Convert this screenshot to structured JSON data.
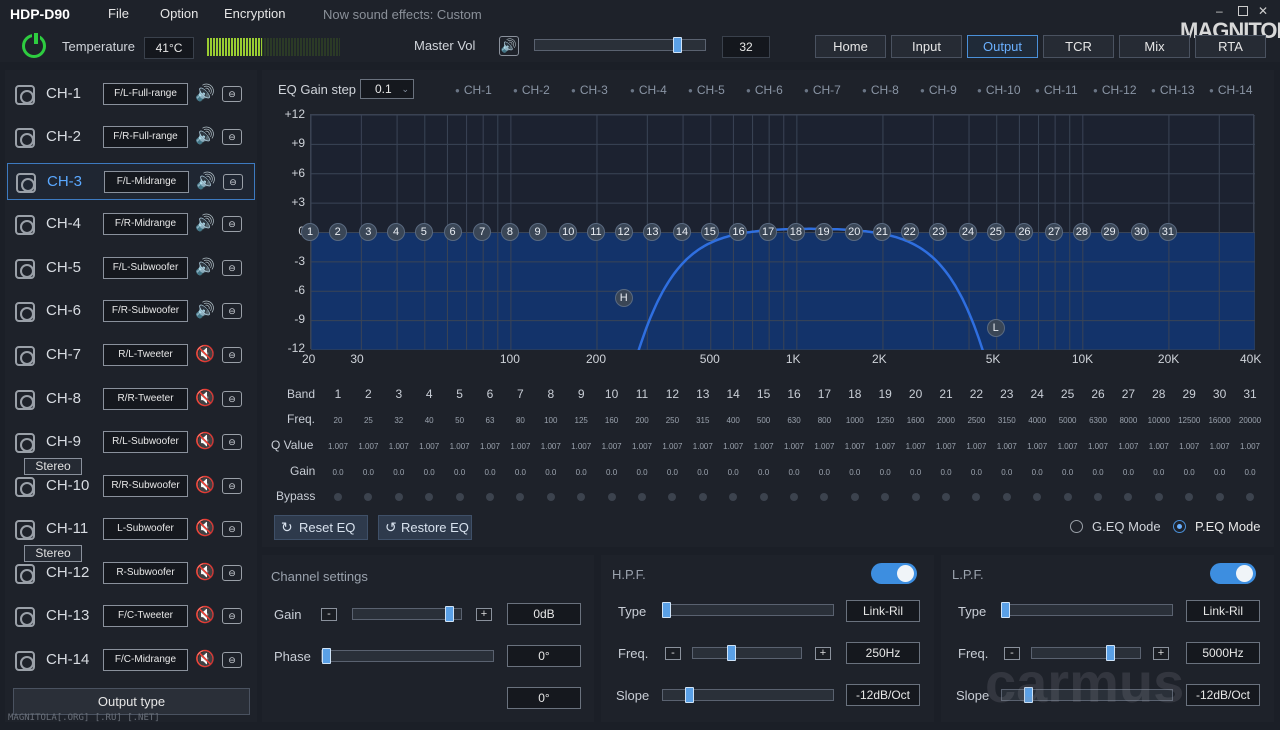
{
  "app": {
    "title": "HDP-D90",
    "menu": [
      "File",
      "Option",
      "Encryption"
    ],
    "sound_effects": "Now sound effects: Custom",
    "logo": "MAGNITOLA"
  },
  "header": {
    "temperature_label": "Temperature",
    "temperature": "41°C",
    "temperature_level": 0.41,
    "master_label": "Master Vol",
    "master_value": "32",
    "master_level": 0.83
  },
  "tabs": [
    {
      "label": "Home"
    },
    {
      "label": "Input"
    },
    {
      "label": "Output",
      "active": true
    },
    {
      "label": "TCR"
    },
    {
      "label": "Mix"
    },
    {
      "label": "RTA"
    }
  ],
  "channels": [
    {
      "name": "CH-1",
      "type": "F/L-Full-range",
      "muted": false
    },
    {
      "name": "CH-2",
      "type": "F/R-Full-range",
      "muted": false
    },
    {
      "name": "CH-3",
      "type": "F/L-Midrange",
      "muted": false,
      "selected": true
    },
    {
      "name": "CH-4",
      "type": "F/R-Midrange",
      "muted": false
    },
    {
      "name": "CH-5",
      "type": "F/L-Subwoofer",
      "muted": false
    },
    {
      "name": "CH-6",
      "type": "F/R-Subwoofer",
      "muted": false
    },
    {
      "name": "CH-7",
      "type": "R/L-Tweeter",
      "muted": true
    },
    {
      "name": "CH-8",
      "type": "R/R-Tweeter",
      "muted": true
    },
    {
      "name": "CH-9",
      "type": "R/L-Subwoofer",
      "muted": true
    },
    {
      "name": "CH-10",
      "type": "R/R-Subwoofer",
      "muted": true
    },
    {
      "name": "CH-11",
      "type": "L-Subwoofer",
      "muted": true
    },
    {
      "name": "CH-12",
      "type": "R-Subwoofer",
      "muted": true
    },
    {
      "name": "CH-13",
      "type": "F/C-Tweeter",
      "muted": true
    },
    {
      "name": "CH-14",
      "type": "F/C-Midrange",
      "muted": true
    }
  ],
  "stereo_label": "Stereo",
  "output_type": "Output type",
  "watermark": "MAGNITOLA[.ORG] [.RU] [.NET]",
  "eq": {
    "gain_step_label": "EQ Gain step",
    "gain_step": "0.1",
    "channel_selectors": [
      "CH-1",
      "CH-2",
      "CH-3",
      "CH-4",
      "CH-5",
      "CH-6",
      "CH-7",
      "CH-8",
      "CH-9",
      "CH-10",
      "CH-11",
      "CH-12",
      "CH-13",
      "CH-14"
    ],
    "y_ticks": [
      "+12",
      "+9",
      "+6",
      "+3",
      "0",
      "-3",
      "-6",
      "-9",
      "-12"
    ],
    "x_ticks": [
      "20",
      "30",
      "100",
      "200",
      "500",
      "1K",
      "2K",
      "5K",
      "10K",
      "20K",
      "40K"
    ],
    "row_labels": {
      "band": "Band",
      "freq": "Freq.",
      "q": "Q Value",
      "gain": "Gain",
      "bypass": "Bypass"
    },
    "bands": [
      1,
      2,
      3,
      4,
      5,
      6,
      7,
      8,
      9,
      10,
      11,
      12,
      13,
      14,
      15,
      16,
      17,
      18,
      19,
      20,
      21,
      22,
      23,
      24,
      25,
      26,
      27,
      28,
      29,
      30,
      31
    ],
    "freqs": [
      "20",
      "25",
      "32",
      "40",
      "50",
      "63",
      "80",
      "100",
      "125",
      "160",
      "200",
      "250",
      "315",
      "400",
      "500",
      "630",
      "800",
      "1000",
      "1250",
      "1600",
      "2000",
      "2500",
      "3150",
      "4000",
      "5000",
      "6300",
      "8000",
      "10000",
      "12500",
      "16000",
      "20000"
    ],
    "q": "1.007",
    "gain": "0.0",
    "hpf_marker": "H",
    "lpf_marker": "L",
    "reset": "Reset EQ",
    "restore": "Restore EQ",
    "geq_mode": "G.EQ Mode",
    "peq_mode": "P.EQ Mode"
  },
  "channel_settings": {
    "title": "Channel settings",
    "gain_label": "Gain",
    "gain_value": "0dB",
    "phase_label": "Phase",
    "phase_value": "0°",
    "extra_value": "0°"
  },
  "hpf": {
    "title": "H.P.F.",
    "type_label": "Type",
    "type_value": "Link-Ril",
    "freq_label": "Freq.",
    "freq_value": "250Hz",
    "slope_label": "Slope",
    "slope_value": "-12dB/Oct"
  },
  "lpf": {
    "title": "L.P.F.",
    "type_label": "Type",
    "type_value": "Link-Ril",
    "freq_label": "Freq.",
    "freq_value": "5000Hz",
    "slope_label": "Slope",
    "slope_value": "-12dB/Oct"
  },
  "overlay_watermark": "carmus"
}
